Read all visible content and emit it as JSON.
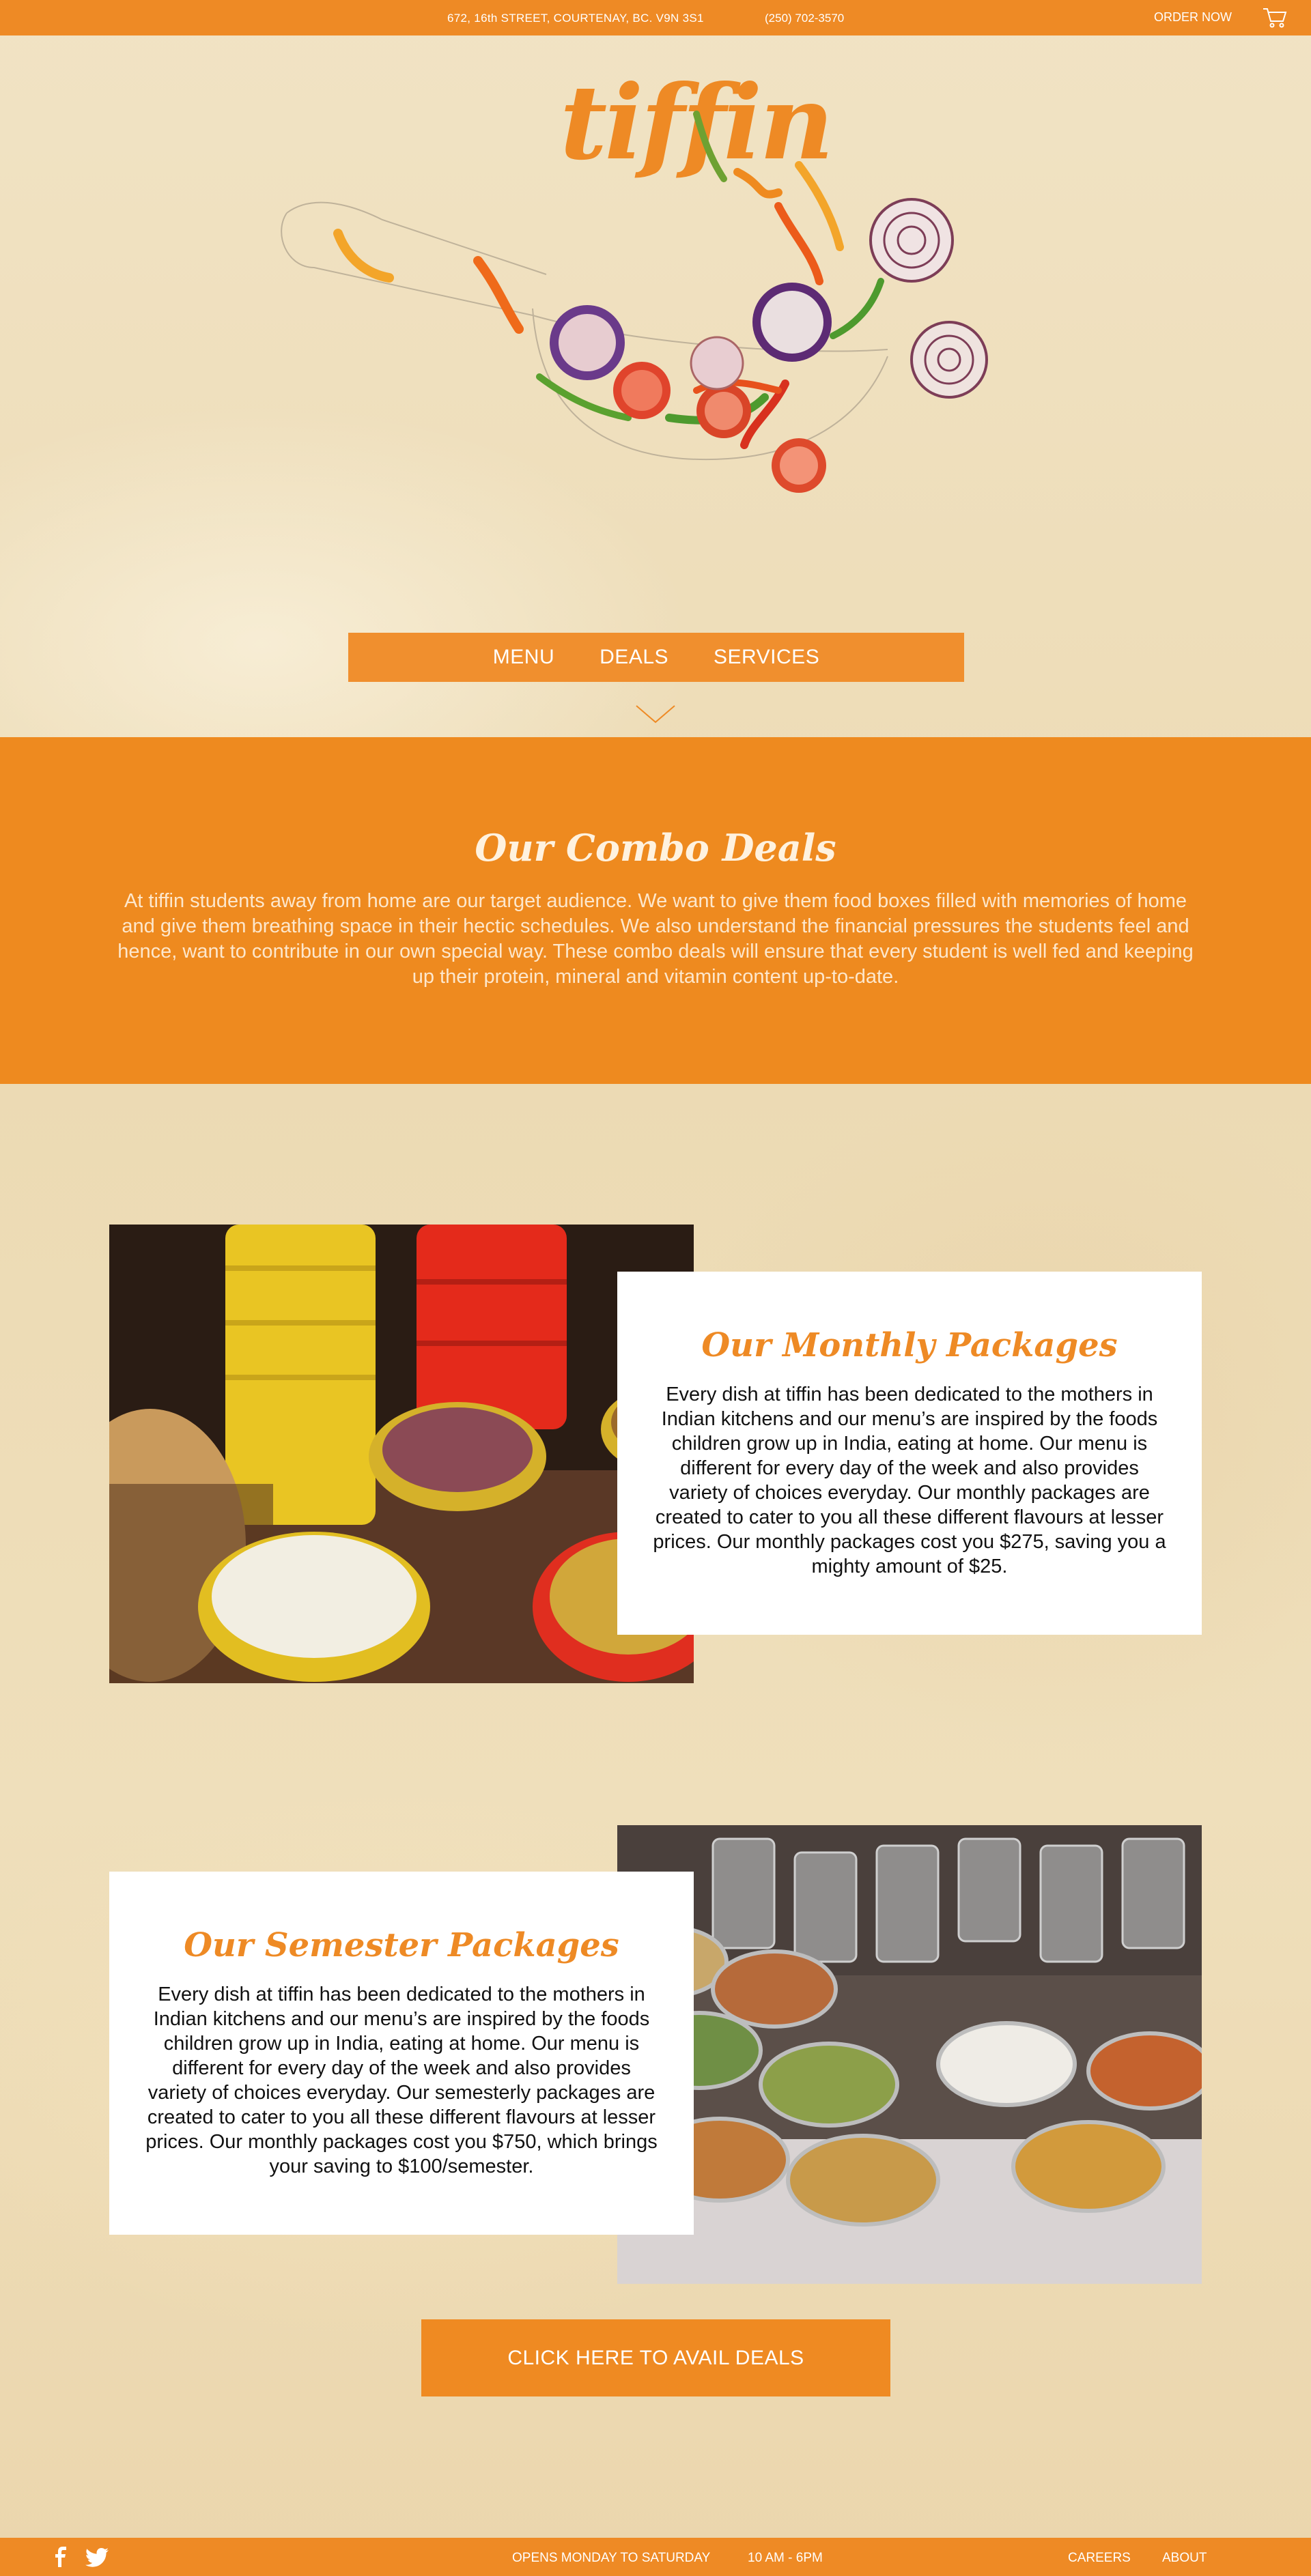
{
  "topbar": {
    "address": "672, 16th STREET, COURTENAY, BC. V9N 3S1",
    "phone": "(250) 702-3570",
    "order_label": "ORDER NOW",
    "cart_icon": "cart-icon"
  },
  "hero": {
    "logo": "tiffin",
    "nav": [
      "MENU",
      "DEALS",
      "SERVICES"
    ]
  },
  "combo": {
    "title": "Our Combo Deals",
    "text": "At tiffin students away from home are our target audience. We want to give them food boxes filled with memories of home and give them breathing space in their hectic schedules. We also understand the financial pressures the students feel and hence, want to contribute in our own special way. These combo deals will ensure that every student is well fed and keeping up their protein, mineral and vitamin content up-to-date."
  },
  "monthly": {
    "title": "Our Monthly Packages",
    "text": "Every dish at tiffin has been dedicated to the mothers in Indian kitchens and our menu’s are inspired by the foods children grow up in India, eating at home. Our menu is different for every day of the week and also provides variety of choices everyday. Our monthly packages are created to cater to you all these different flavours at lesser prices. Our monthly packages cost you $275, saving you a mighty amount of $25."
  },
  "semester": {
    "title": "Our Semester Packages",
    "text": "Every dish at tiffin has been dedicated to the mothers in Indian kitchens and our menu’s are inspired by the foods children grow up in India, eating at home. Our menu is different for every day of the week and also provides variety of choices everyday. Our semesterly packages are created to cater to you all these different flavours at lesser prices. Our monthly packages cost you $750, which brings your saving to $100/semester."
  },
  "cta": {
    "label": "CLICK HERE TO AVAIL DEALS"
  },
  "footer": {
    "hours_label": "OPENS MONDAY TO SATURDAY",
    "hours_time": "10 AM - 6PM",
    "careers": "CAREERS",
    "about": "ABOUT",
    "icons": [
      "facebook-icon",
      "twitter-icon"
    ]
  },
  "colors": {
    "accent": "#ee8a25",
    "paper": "#efe0bd",
    "card": "#ffffff"
  }
}
